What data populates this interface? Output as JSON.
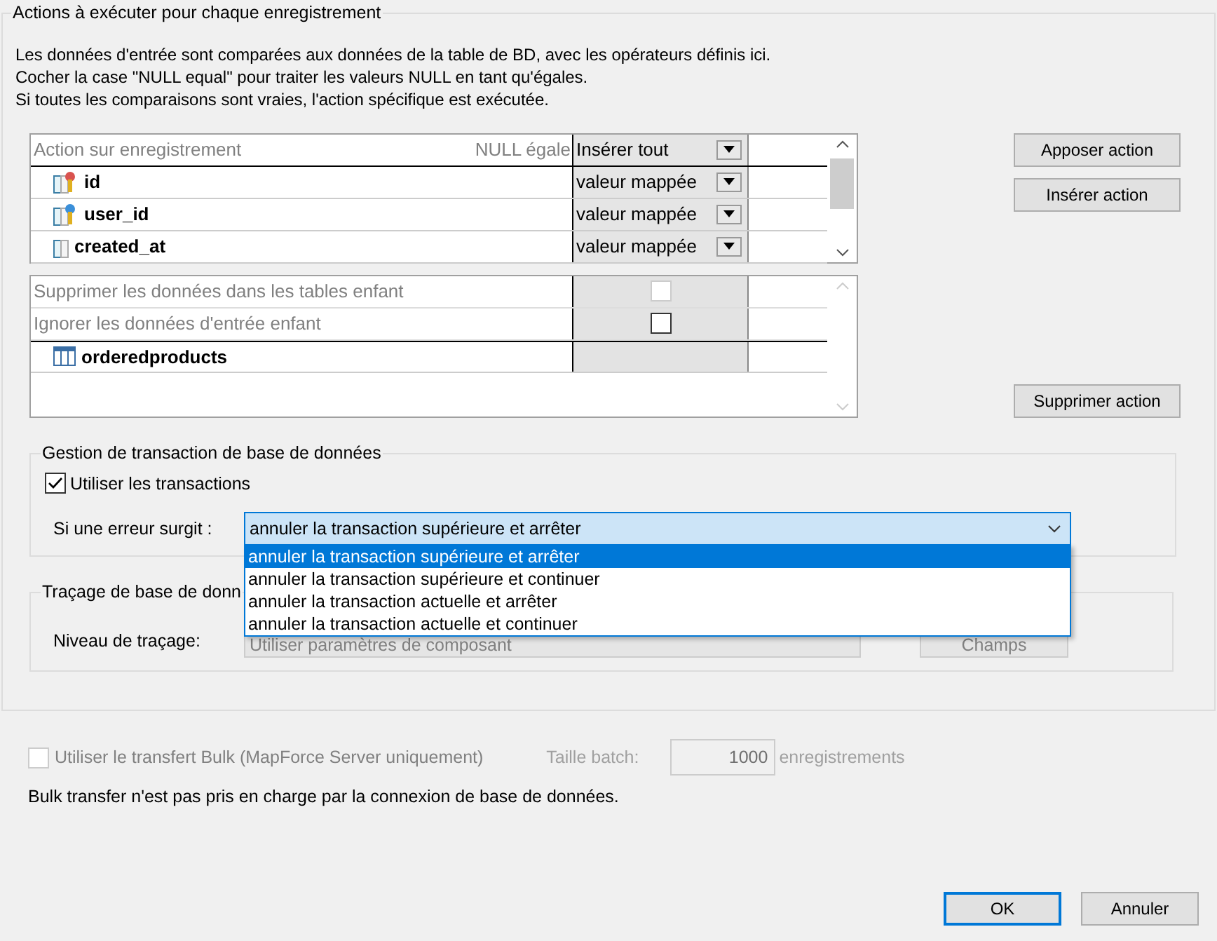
{
  "section": {
    "title": "Actions à exécuter pour chaque enregistrement",
    "description": [
      "Les données d'entrée sont comparées aux données de la table de BD, avec les opérateurs définis ici.",
      "Cocher la case \"NULL equal\" pour traiter les valeurs NULL en tant qu'égales.",
      "Si toutes les comparaisons sont vraies, l'action spécifique est exécutée."
    ]
  },
  "record_grid": {
    "header": {
      "label": "Action sur enregistrement",
      "null_label": "NULL égale",
      "action": "Insérer tout"
    },
    "rows": [
      {
        "kind": "primary_key",
        "name": "id",
        "value": "valeur mappée"
      },
      {
        "kind": "foreign_key",
        "name": "user_id",
        "value": "valeur mappée"
      },
      {
        "kind": "column",
        "name": "created_at",
        "value": "valeur mappée"
      }
    ]
  },
  "child_grid": {
    "rows": [
      {
        "kind": "option",
        "label": "Supprimer les données dans les tables enfant",
        "checked": false,
        "disabled": true
      },
      {
        "kind": "option",
        "label": "Ignorer les données d'entrée enfant",
        "checked": false,
        "disabled": false
      },
      {
        "kind": "table",
        "label": "orderedproducts"
      }
    ]
  },
  "action_buttons": [
    "Apposer action",
    "Insérer action",
    "Supprimer action"
  ],
  "transactions": {
    "title": "Gestion de transaction de base de données",
    "use_transactions": {
      "label": "Utiliser les transactions",
      "checked": true
    },
    "on_error": {
      "label": "Si une erreur surgit :",
      "value": "annuler la transaction supérieure et arrêter",
      "expanded": true,
      "options": [
        {
          "label": "annuler la transaction supérieure et arrêter",
          "selected": true
        },
        {
          "label": "annuler la transaction supérieure et continuer",
          "selected": false
        },
        {
          "label": "annuler la transaction actuelle et arrêter",
          "selected": false
        },
        {
          "label": "annuler la transaction actuelle et continuer",
          "selected": false
        }
      ]
    }
  },
  "tracing": {
    "title": "Traçage de base de donn",
    "level_label": "Niveau de traçage:",
    "level_value": "Utiliser paramètres de composant",
    "fields_button": "Champs"
  },
  "bulk": {
    "label": "Utiliser le transfert Bulk (MapForce Server uniquement)",
    "checked": false,
    "disabled": true,
    "batch_label": "Taille batch:",
    "batch_value": "1000",
    "unit": "enregistrements",
    "note": "Bulk transfer n'est pas pris en charge par la connexion de base de données."
  },
  "dialog_buttons": [
    {
      "label": "OK",
      "default": true
    },
    {
      "label": "Annuler",
      "default": false
    }
  ]
}
